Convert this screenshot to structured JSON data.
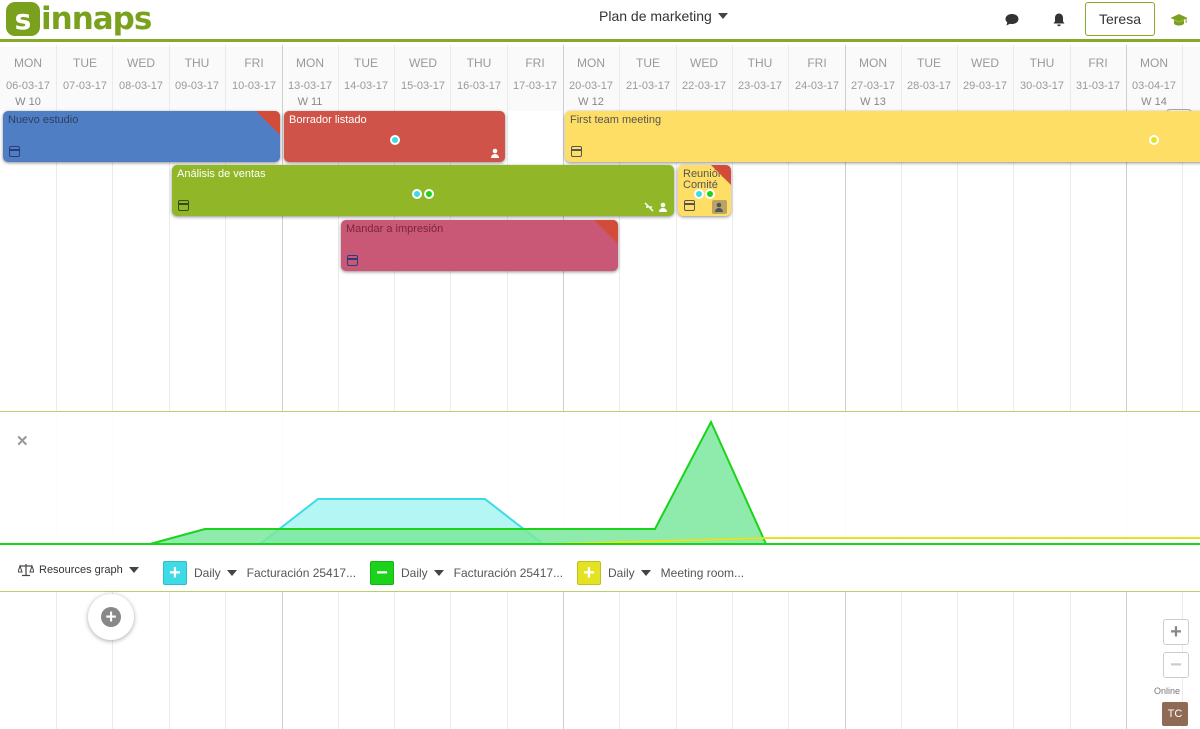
{
  "app": {
    "logo_text": "innaps",
    "logo_mark": "s",
    "project_name": "Plan de marketing",
    "user_name": "Teresa"
  },
  "days": [
    {
      "dn": "MON",
      "date": "06-03-17",
      "week": "W 10"
    },
    {
      "dn": "TUE",
      "date": "07-03-17",
      "week": ""
    },
    {
      "dn": "WED",
      "date": "08-03-17",
      "week": ""
    },
    {
      "dn": "THU",
      "date": "09-03-17",
      "week": ""
    },
    {
      "dn": "FRI",
      "date": "10-03-17",
      "week": ""
    },
    {
      "dn": "MON",
      "date": "13-03-17",
      "week": "W 11"
    },
    {
      "dn": "TUE",
      "date": "14-03-17",
      "week": ""
    },
    {
      "dn": "WED",
      "date": "15-03-17",
      "week": ""
    },
    {
      "dn": "THU",
      "date": "16-03-17",
      "week": ""
    },
    {
      "dn": "FRI",
      "date": "17-03-17",
      "week": ""
    },
    {
      "dn": "MON",
      "date": "20-03-17",
      "week": "W 12"
    },
    {
      "dn": "TUE",
      "date": "21-03-17",
      "week": ""
    },
    {
      "dn": "WED",
      "date": "22-03-17",
      "week": ""
    },
    {
      "dn": "THU",
      "date": "23-03-17",
      "week": ""
    },
    {
      "dn": "FRI",
      "date": "24-03-17",
      "week": ""
    },
    {
      "dn": "MON",
      "date": "27-03-17",
      "week": "W 13"
    },
    {
      "dn": "TUE",
      "date": "28-03-17",
      "week": ""
    },
    {
      "dn": "WED",
      "date": "29-03-17",
      "week": ""
    },
    {
      "dn": "THU",
      "date": "30-03-17",
      "week": ""
    },
    {
      "dn": "FRI",
      "date": "31-03-17",
      "week": ""
    },
    {
      "dn": "MON",
      "date": "03-04-17",
      "week": "W 14"
    }
  ],
  "tasks": [
    {
      "name": "Nuevo estudio",
      "color": "#4f7ec5",
      "text_color": "#2d3f5e",
      "corner": true
    },
    {
      "name": "Borrador listado",
      "color": "#cf5348",
      "text_color": "#ffffff",
      "corner": false
    },
    {
      "name": "First team meeting",
      "color": "#ffde66",
      "text_color": "#555555",
      "corner": false
    },
    {
      "name": "Análisis de ventas",
      "color": "#91b628",
      "text_color": "#ffffff",
      "corner": false
    },
    {
      "name": "Reunión Comité",
      "color": "#ffde66",
      "text_color": "#555555",
      "corner": true
    },
    {
      "name": "Mandar a impresión",
      "color": "#c85876",
      "text_color": "#7a2540",
      "corner": true
    }
  ],
  "resources": {
    "graph_label": "Resources graph",
    "items": [
      {
        "color": "#3ddbe6",
        "sign": "+",
        "period": "Daily",
        "label": "Facturación 25417..."
      },
      {
        "color": "#1bd31b",
        "sign": "−",
        "period": "Daily",
        "label": "Facturación 25417..."
      },
      {
        "color": "#e3e323",
        "sign": "+",
        "period": "Daily",
        "label": "Meeting room..."
      }
    ]
  },
  "status": {
    "online_label": "Online",
    "avatar_initials": "TC"
  },
  "zoom": {
    "in": "+",
    "out": "−"
  },
  "icons": [
    "chat-icon",
    "bell-icon",
    "graduation-cap-icon",
    "search-icon",
    "calendar-icon",
    "person-icon",
    "scale-icon",
    "close-icon",
    "add-icon"
  ]
}
